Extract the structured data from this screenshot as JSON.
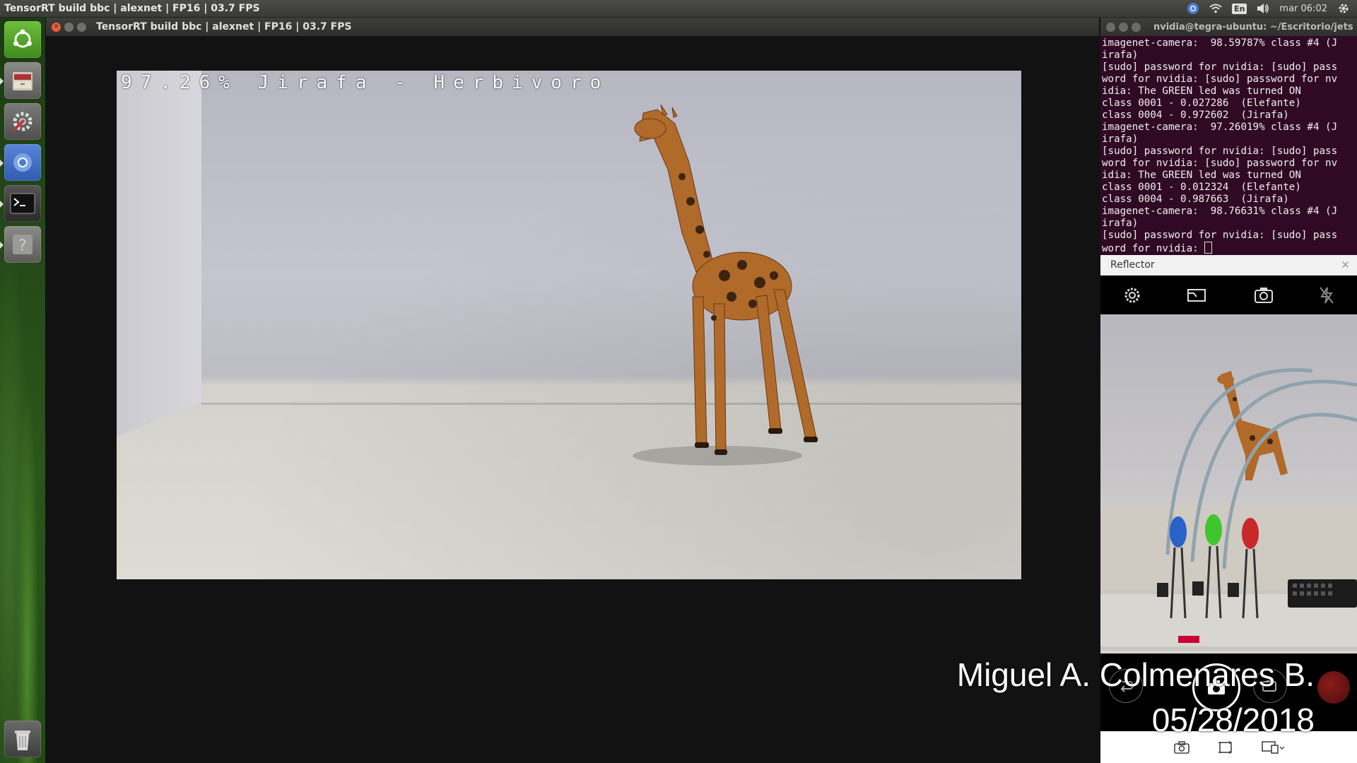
{
  "top_panel": {
    "title": "TensorRT build bbc | alexnet | FP16 | 03.7 FPS",
    "keyboard_layout": "En",
    "clock": "mar 06:02"
  },
  "launcher": {
    "items": [
      "ubuntu-logo",
      "files",
      "system-settings",
      "chromium",
      "terminal",
      "help"
    ],
    "trash": "trash"
  },
  "main_window": {
    "title": "TensorRT build bbc | alexnet | FP16 | 03.7 FPS",
    "overlay": "97.26% Jirafa - Herbivoro"
  },
  "terminal": {
    "title": "nvidia@tegra-ubuntu: ~/Escritorio/jets",
    "lines": [
      "imagenet-camera:  98.59787% class #4 (J",
      "irafa)",
      "[sudo] password for nvidia: [sudo] pass",
      "word for nvidia: [sudo] password for nv",
      "idia: The GREEN led was turned ON",
      "class 0001 - 0.027286  (Elefante)",
      "class 0004 - 0.972602  (Jirafa)",
      "imagenet-camera:  97.26019% class #4 (J",
      "irafa)",
      "[sudo] password for nvidia: [sudo] pass",
      "word for nvidia: [sudo] password for nv",
      "idia: The GREEN led was turned ON",
      "class 0001 - 0.012324  (Elefante)",
      "class 0004 - 0.987663  (Jirafa)",
      "imagenet-camera:  98.76631% class #4 (J",
      "irafa)",
      "[sudo] password for nvidia: [sudo] pass",
      "word for nvidia: "
    ]
  },
  "reflector": {
    "title": "Reflector",
    "toolbar_icons": [
      "settings-icon",
      "camera-swap-icon",
      "camera-flip-icon",
      "flash-off-icon"
    ],
    "bottom_icons": [
      "photo-icon",
      "crop-icon",
      "cast-icon"
    ]
  },
  "watermark": {
    "name": "Miguel A. Colmenares B.",
    "date": "05/28/2018"
  },
  "colors": {
    "panel": "#3a3a37",
    "terminal_bg": "#300a24",
    "close_button": "#e8603a"
  }
}
